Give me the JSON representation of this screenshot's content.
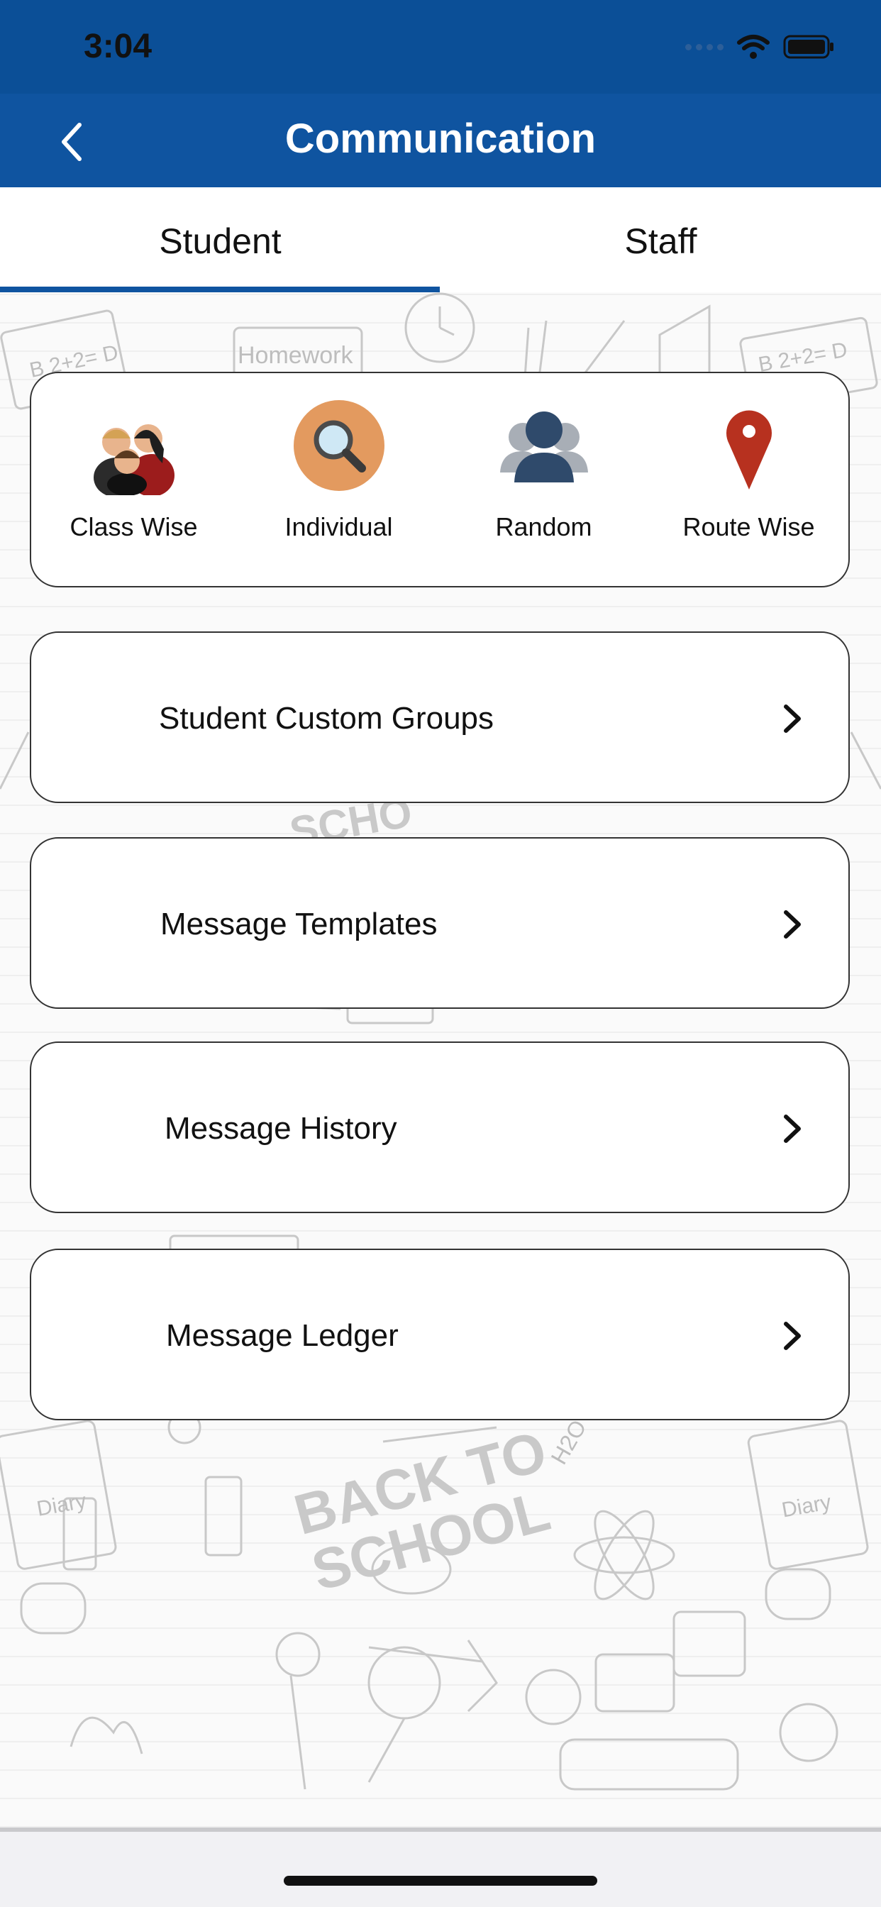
{
  "status_bar": {
    "time": "3:04",
    "icons": [
      "signal-icon",
      "wifi-icon",
      "battery-icon"
    ]
  },
  "nav": {
    "title": "Communication",
    "back_icon": "chevron-left-icon"
  },
  "tabs": [
    {
      "label": "Student",
      "selected": true
    },
    {
      "label": "Staff",
      "selected": false
    }
  ],
  "options": [
    {
      "label": "Class Wise",
      "icon": "class-group-icon"
    },
    {
      "label": "Individual",
      "icon": "magnifier-icon"
    },
    {
      "label": "Random",
      "icon": "people-icon"
    },
    {
      "label": "Route Wise",
      "icon": "map-pin-icon"
    }
  ],
  "menu": [
    {
      "label": "Student Custom Groups"
    },
    {
      "label": "Message Templates"
    },
    {
      "label": "Message History"
    },
    {
      "label": "Message Ledger"
    }
  ],
  "background": {
    "doodle_texts": [
      "Homework",
      "BACK TO",
      "SCHOOL",
      "B 2+2= D",
      "Diary",
      "H2O"
    ]
  },
  "colors": {
    "brand": "#0f54a0",
    "status_bar": "#0b4f97",
    "individual_icon": "#e39a5f",
    "pin": "#b7311f",
    "people": "#2f4a6b"
  }
}
